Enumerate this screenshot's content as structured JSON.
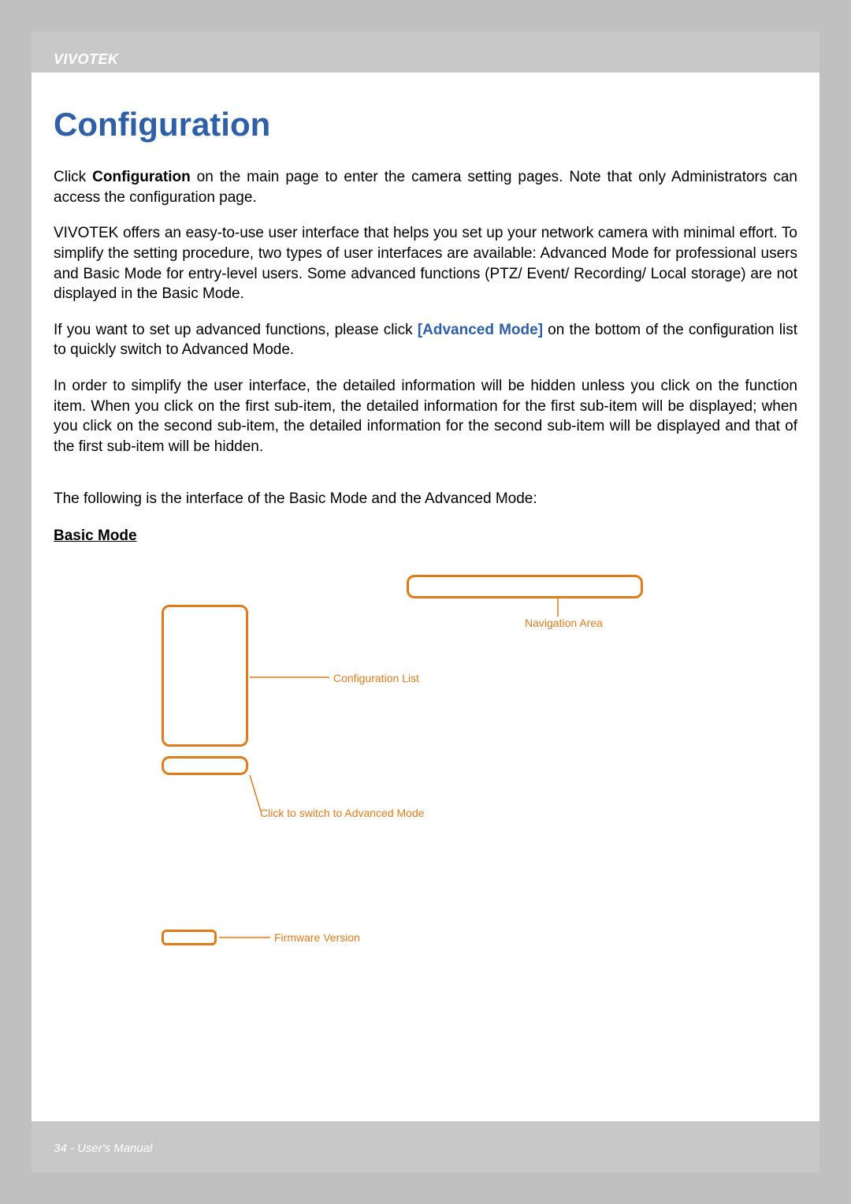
{
  "header": {
    "brand": "VIVOTEK"
  },
  "title": "Configuration",
  "paragraphs": {
    "p1_pre": "Click ",
    "p1_bold": "Configuration",
    "p1_post": " on the main page to enter the camera setting pages. Note that only Administrators can access the configuration page.",
    "p2": "VIVOTEK offers an easy-to-use user interface that helps you set up your network camera with minimal effort. To simplify the setting procedure, two types of user interfaces are available: Advanced Mode for professional users and Basic Mode for entry-level users. Some advanced functions (PTZ/ Event/ Recording/ Local storage) are not displayed in the Basic Mode.",
    "p3_pre": "If you want to set up advanced functions, please click ",
    "p3_link": "[Advanced Mode]",
    "p3_post": " on the bottom of the configuration list to quickly switch to Advanced Mode.",
    "p4": "In order to simplify the user interface, the detailed information will be hidden unless you click on the function item. When you click on the first sub-item, the detailed information for the first sub-item will be displayed; when you click on the second sub-item, the detailed information for the second sub-item will be displayed and that of the first sub-item will be hidden.",
    "p5": "The following is the interface of the Basic Mode and the Advanced Mode:"
  },
  "section_heading": "Basic Mode",
  "diagram": {
    "labels": {
      "navigation": "Navigation Area",
      "config_list": "Configuration List",
      "switch_mode": "Click to switch to Advanced Mode",
      "firmware": "Firmware Version"
    }
  },
  "footer": {
    "page_info": "34 - User's Manual"
  }
}
